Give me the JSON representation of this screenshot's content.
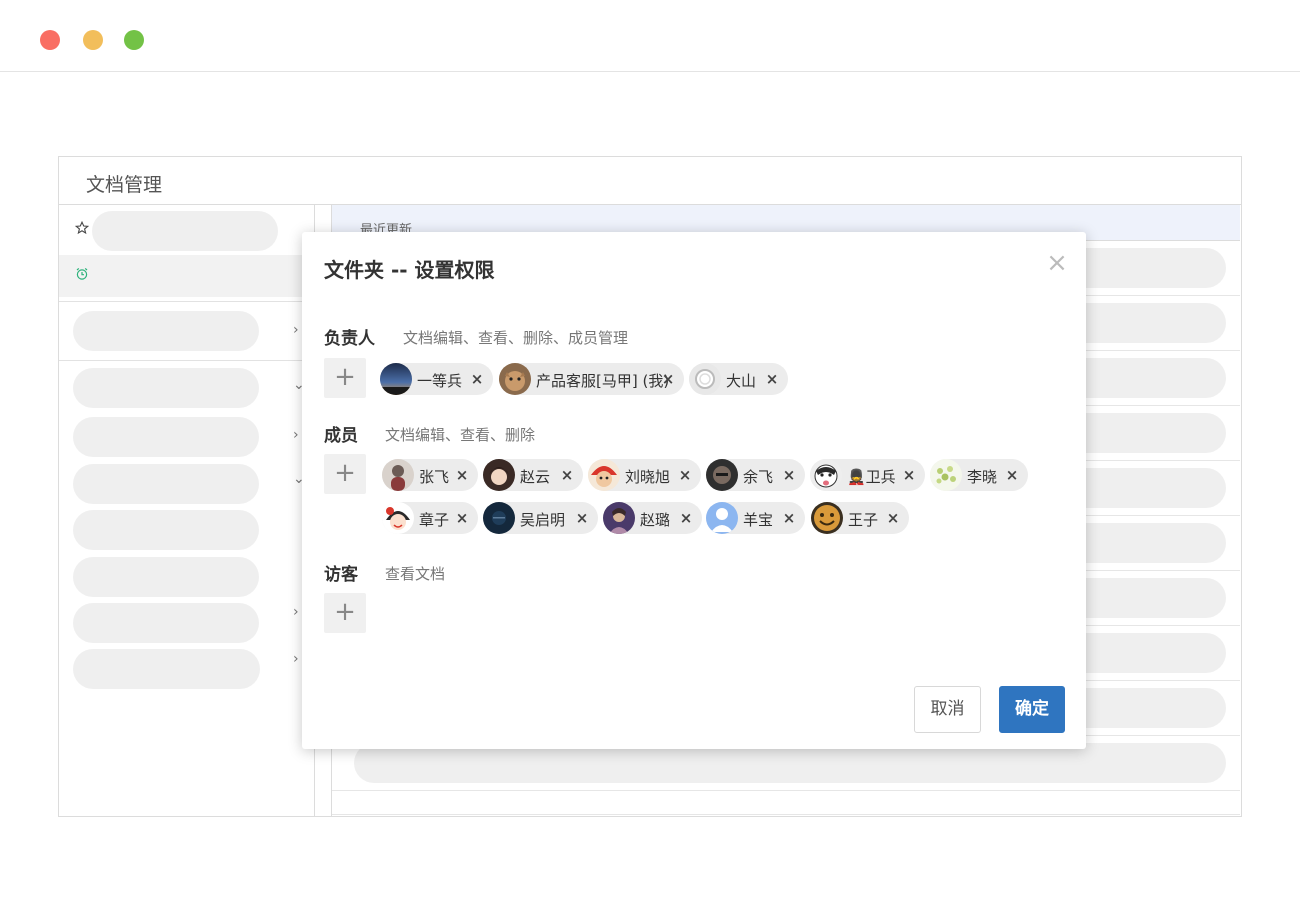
{
  "app": {
    "title": "文档管理"
  },
  "content": {
    "header_label": "最近更新"
  },
  "modal": {
    "title": "文件夹 -- 设置权限",
    "close_symbol": "×",
    "sections": {
      "owner": {
        "title": "负责人",
        "description": "文档编辑、查看、删除、成员管理",
        "people": [
          {
            "name": "一等兵",
            "avatar": "night-sky"
          },
          {
            "name": "产品客服[马甲] (我)",
            "avatar": "cat"
          },
          {
            "name": "大山",
            "avatar": "ring"
          }
        ]
      },
      "member": {
        "title": "成员",
        "description": "文档编辑、查看、删除",
        "people": [
          {
            "name": "张飞",
            "avatar": "figure"
          },
          {
            "name": "赵云",
            "avatar": "dark-hair"
          },
          {
            "name": "刘晓旭",
            "avatar": "red-cap"
          },
          {
            "name": "余飞",
            "avatar": "dark-face"
          },
          {
            "name": "💂卫兵",
            "avatar": "husky"
          },
          {
            "name": "李晓",
            "avatar": "flowers"
          },
          {
            "name": "章子",
            "avatar": "cartoon-girl"
          },
          {
            "name": "吴启明",
            "avatar": "dark-blue"
          },
          {
            "name": "赵璐",
            "avatar": "purple"
          },
          {
            "name": "羊宝",
            "avatar": "default-user"
          },
          {
            "name": "王子",
            "avatar": "smiley"
          }
        ]
      },
      "visitor": {
        "title": "访客",
        "description": "查看文档",
        "people": []
      }
    },
    "add_symbol": "+",
    "remove_symbol": "×",
    "cancel_label": "取消",
    "confirm_label": "确定"
  },
  "colors": {
    "primary": "#2f75c0",
    "mac_red": "#f96e63",
    "mac_yellow": "#f2be5b",
    "mac_green": "#73c246"
  }
}
